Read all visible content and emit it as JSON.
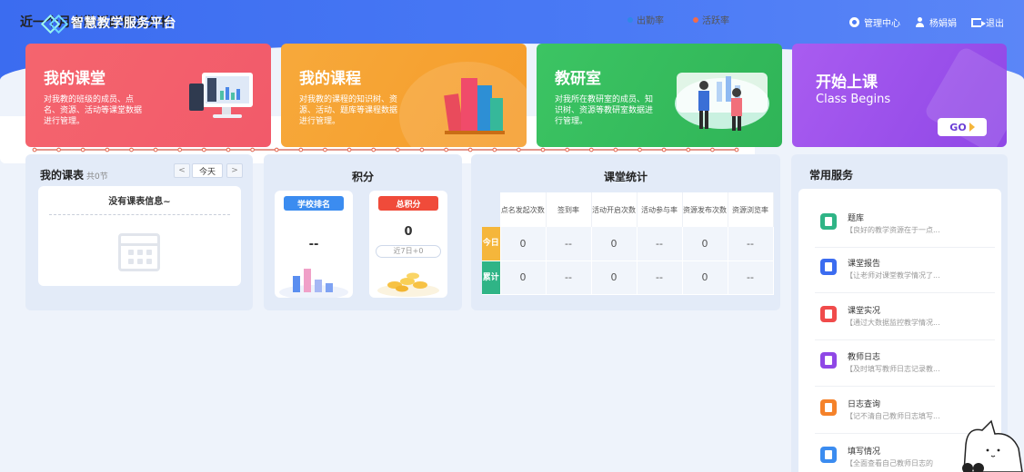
{
  "header": {
    "app_title": "智慧教学服务平台",
    "actions": [
      {
        "label": "管理中心",
        "icon": "gear-icon"
      },
      {
        "label": "杨娟娟",
        "icon": "user-icon"
      },
      {
        "label": "退出",
        "icon": "logout-icon"
      }
    ]
  },
  "cards": [
    {
      "title": "我的课堂",
      "desc": "对我教的班级的成员、点名、资源、活动等课堂数据进行管理。",
      "color": "#f4656e"
    },
    {
      "title": "我的课程",
      "desc": "对我教的课程的知识树、资源、活动、题库等课程数据进行管理。",
      "color": "#f7a93b"
    },
    {
      "title": "教研室",
      "desc": "对我所在教研室的成员、知识树、资源等教研室数据进行管理。",
      "color": "#3cc463"
    },
    {
      "title": "开始上课",
      "subtitle": "Class Begins",
      "button": "GO",
      "color": "#a95cf0"
    }
  ],
  "schedule": {
    "title": "我的课表",
    "count": "共0节",
    "prev": "<",
    "today": "今天",
    "next": ">",
    "empty": "没有课表信息~"
  },
  "points": {
    "title": "积分",
    "school_rank_label": "学校排名",
    "school_rank_value": "--",
    "total_label": "总积分",
    "total_value": "0",
    "recent": "近7日+0"
  },
  "class_stats": {
    "title": "课堂统计",
    "columns": [
      "点名发起次数",
      "签到率",
      "活动开启次数",
      "活动参与率",
      "资源发布次数",
      "资源浏览率"
    ],
    "rows": [
      {
        "label": "今日",
        "values": [
          "0",
          "--",
          "0",
          "--",
          "0",
          "--"
        ],
        "color": "#f5b63b"
      },
      {
        "label": "累计",
        "values": [
          "0",
          "--",
          "0",
          "--",
          "0",
          "--"
        ],
        "color": "#2fb486"
      }
    ]
  },
  "services": {
    "title": "常用服务",
    "items": [
      {
        "name": "题库",
        "desc": "【良好的教学资源在于一点...",
        "color": "#2fb486",
        "icon": "question-bank-icon"
      },
      {
        "name": "课堂报告",
        "desc": "【让老师对课堂教学情况了...",
        "color": "#3b6cf0",
        "icon": "report-icon"
      },
      {
        "name": "课堂实况",
        "desc": "【通过大数据监控教学情况...",
        "color": "#f04b4b",
        "icon": "live-icon"
      },
      {
        "name": "教师日志",
        "desc": "【及时填写教师日志记录教...",
        "color": "#8f47e6",
        "icon": "log-icon"
      },
      {
        "name": "日志查询",
        "desc": "【记不清自己教师日志填写...",
        "color": "#f5822a",
        "icon": "log-search-icon"
      },
      {
        "name": "填写情况",
        "desc": "【全面查看自己教师日志的",
        "color": "#3b8cf0",
        "icon": "fill-status-icon"
      }
    ]
  },
  "attendance_chart": {
    "title": "近一个月考勤活跃情况分析",
    "legend": [
      {
        "label": "出勤率",
        "color": "#2f88e8"
      },
      {
        "label": "活跃率",
        "color": "#f26b4b"
      }
    ]
  },
  "chart_data": {
    "type": "line",
    "title": "近一个月考勤活跃情况分析",
    "x_count": 30,
    "series": [
      {
        "name": "出勤率",
        "values": [
          0,
          0,
          0,
          0,
          0,
          0,
          0,
          0,
          0,
          0,
          0,
          0,
          0,
          0,
          0,
          0,
          0,
          0,
          0,
          0,
          0,
          0,
          0,
          0,
          0,
          0,
          0,
          0,
          0,
          0
        ]
      },
      {
        "name": "活跃率",
        "values": [
          0,
          0,
          0,
          0,
          0,
          0,
          0,
          0,
          0,
          0,
          0,
          0,
          0,
          0,
          0,
          0,
          0,
          0,
          0,
          0,
          0,
          0,
          0,
          0,
          0,
          0,
          0,
          0,
          0,
          0
        ]
      }
    ]
  }
}
